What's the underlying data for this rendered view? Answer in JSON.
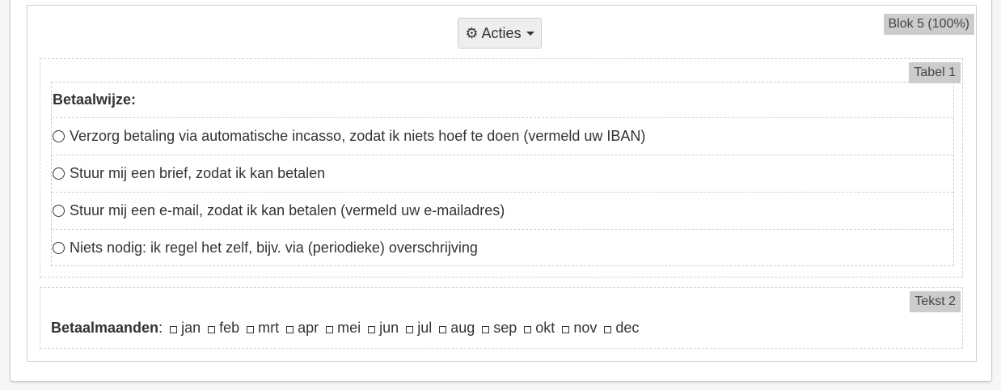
{
  "block": {
    "tag": "Blok 5 (100%)",
    "actions_label": "Acties",
    "actions_icon": "gear-icon"
  },
  "table": {
    "tag": "Tabel 1",
    "header": "Betaalwijze:",
    "options": [
      "Verzorg betaling via automatische incasso, zodat ik niets hoef te doen (vermeld uw IBAN)",
      "Stuur mij een brief, zodat ik kan betalen",
      "Stuur mij een e-mail, zodat ik kan betalen (vermeld uw e-mailadres)",
      "Niets nodig: ik regel het zelf, bijv. via (periodieke) overschrijving"
    ]
  },
  "text": {
    "tag": "Tekst 2",
    "label": "Betaalmaanden",
    "months": [
      "jan",
      "feb",
      "mrt",
      "apr",
      "mei",
      "jun",
      "jul",
      "aug",
      "sep",
      "okt",
      "nov",
      "dec"
    ]
  }
}
